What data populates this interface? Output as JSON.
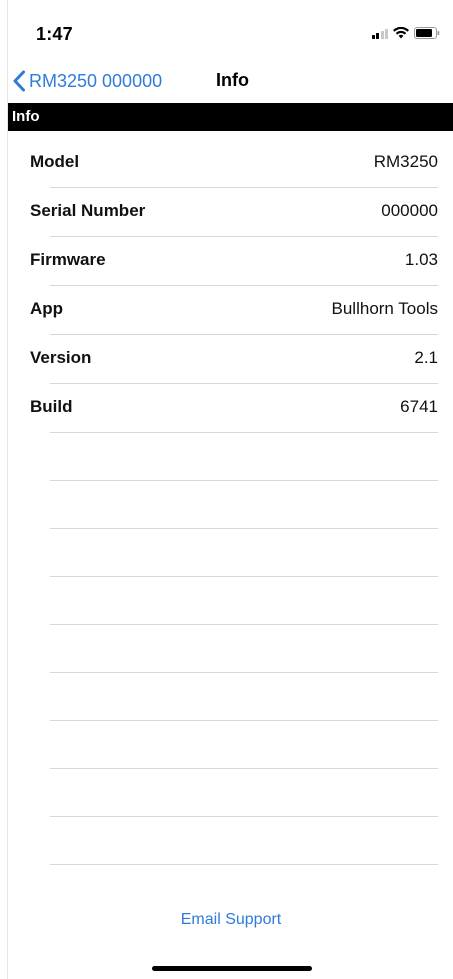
{
  "status_bar": {
    "time": "1:47",
    "signal_icon": "cellular-signal-icon",
    "wifi_icon": "wifi-icon",
    "battery_icon": "battery-icon"
  },
  "nav_bar": {
    "back_label": "RM3250 000000",
    "back_icon": "chevron-left-icon",
    "title": "Info"
  },
  "section": {
    "header": "Info"
  },
  "rows": [
    {
      "label": "Model",
      "value": "RM3250"
    },
    {
      "label": "Serial Number",
      "value": "000000"
    },
    {
      "label": "Firmware",
      "value": "1.03"
    },
    {
      "label": "App",
      "value": "Bullhorn Tools"
    },
    {
      "label": "Version",
      "value": "2.1"
    },
    {
      "label": "Build",
      "value": "6741"
    }
  ],
  "footer": {
    "email_support_label": "Email Support"
  },
  "colors": {
    "accent": "#2f7bd9",
    "section_header_bg": "#000000",
    "separator": "#d6d6d6"
  }
}
